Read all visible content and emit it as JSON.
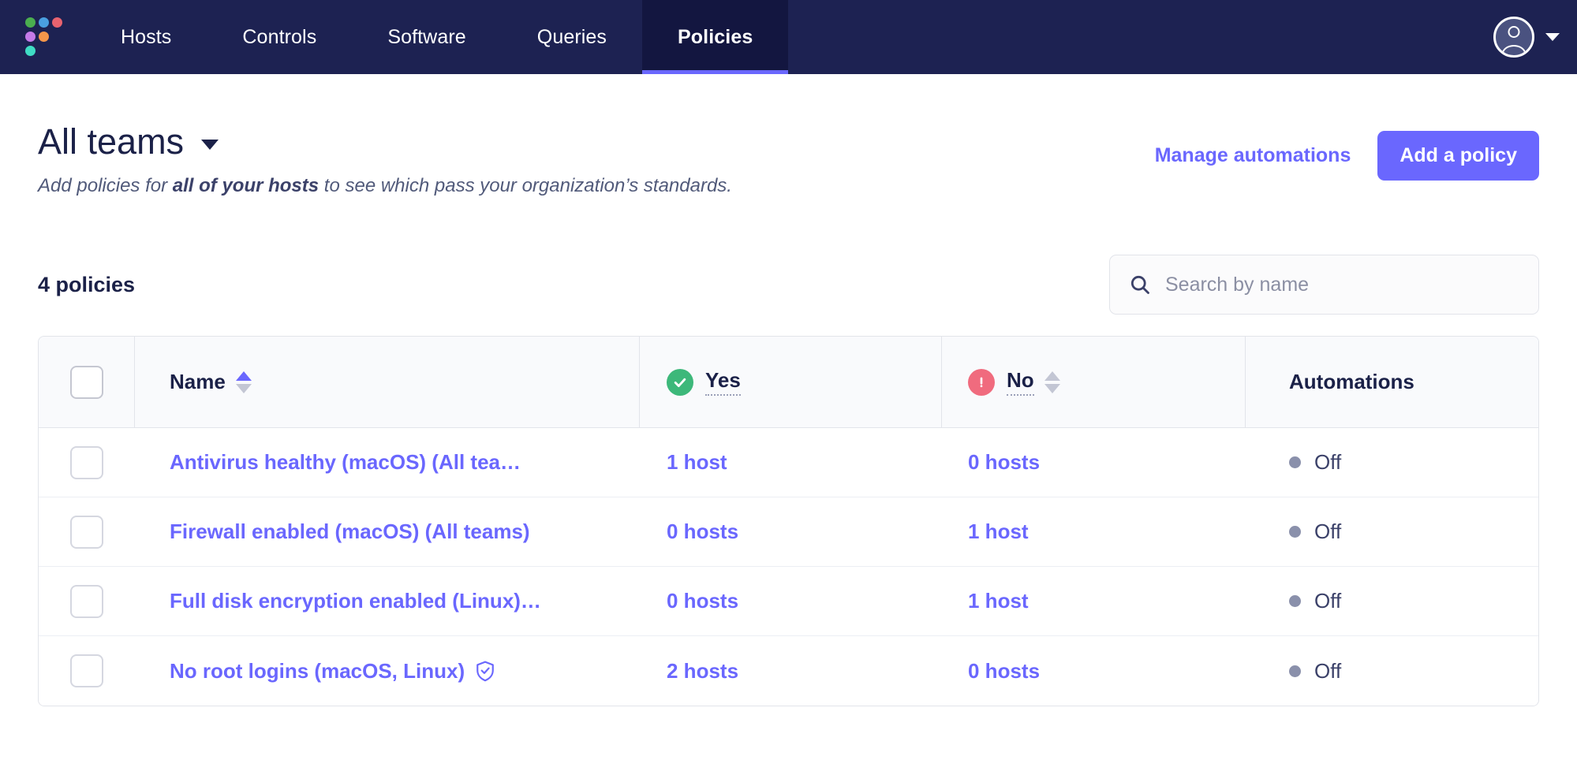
{
  "nav": {
    "logo_name": "fleet-logo",
    "items": [
      {
        "label": "Hosts",
        "active": false
      },
      {
        "label": "Controls",
        "active": false
      },
      {
        "label": "Software",
        "active": false
      },
      {
        "label": "Queries",
        "active": false
      },
      {
        "label": "Policies",
        "active": true
      }
    ],
    "user_menu": {
      "avatar": "user-avatar-icon",
      "caret": "chevron-down-icon"
    }
  },
  "header": {
    "title": "All teams",
    "title_caret": "chevron-down-icon",
    "subtitle_pre": "Add policies for ",
    "subtitle_bold": "all of your hosts",
    "subtitle_post": " to see which pass your organization’s standards.",
    "manage_automations_label": "Manage automations",
    "add_policy_label": "Add a policy"
  },
  "toolbar": {
    "policy_count_label": "4 policies",
    "search_placeholder": "Search by name",
    "search_value": "",
    "search_icon": "search-icon"
  },
  "table": {
    "columns": [
      {
        "key": "checkbox",
        "label": ""
      },
      {
        "key": "name",
        "label": "Name",
        "sort": "asc"
      },
      {
        "key": "yes",
        "label": "Yes",
        "icon": "check-circle-icon",
        "dotted": true
      },
      {
        "key": "no",
        "label": "No",
        "icon": "alert-circle-icon",
        "dotted": true,
        "sort": "none"
      },
      {
        "key": "automations",
        "label": "Automations"
      }
    ],
    "rows": [
      {
        "name": "Antivirus healthy (macOS) (All tea…)",
        "name_display": "Antivirus healthy (macOS) (All tea…",
        "critical": false,
        "yes": "1 host",
        "no": "0 hosts",
        "automations": "Off"
      },
      {
        "name": "Firewall enabled (macOS) (All teams)",
        "name_display": "Firewall enabled (macOS) (All teams)",
        "critical": false,
        "yes": "0 hosts",
        "no": "1 host",
        "automations": "Off"
      },
      {
        "name": "Full disk encryption enabled (Linux)…",
        "name_display": "Full disk encryption enabled (Linux)…",
        "critical": false,
        "yes": "0 hosts",
        "no": "1 host",
        "automations": "Off"
      },
      {
        "name": "No root logins (macOS, Linux)",
        "name_display": "No root logins (macOS, Linux)",
        "critical": true,
        "critical_icon": "shield-check-icon",
        "yes": "2 hosts",
        "no": "0 hosts",
        "automations": "Off"
      }
    ]
  },
  "colors": {
    "nav_bg": "#1d2252",
    "nav_active_bg": "#131640",
    "accent": "#6a67fe",
    "text_dark": "#1b2148",
    "pass_green": "#3db87a",
    "fail_red": "#f06b7e",
    "off_gray": "#8a90ab"
  }
}
